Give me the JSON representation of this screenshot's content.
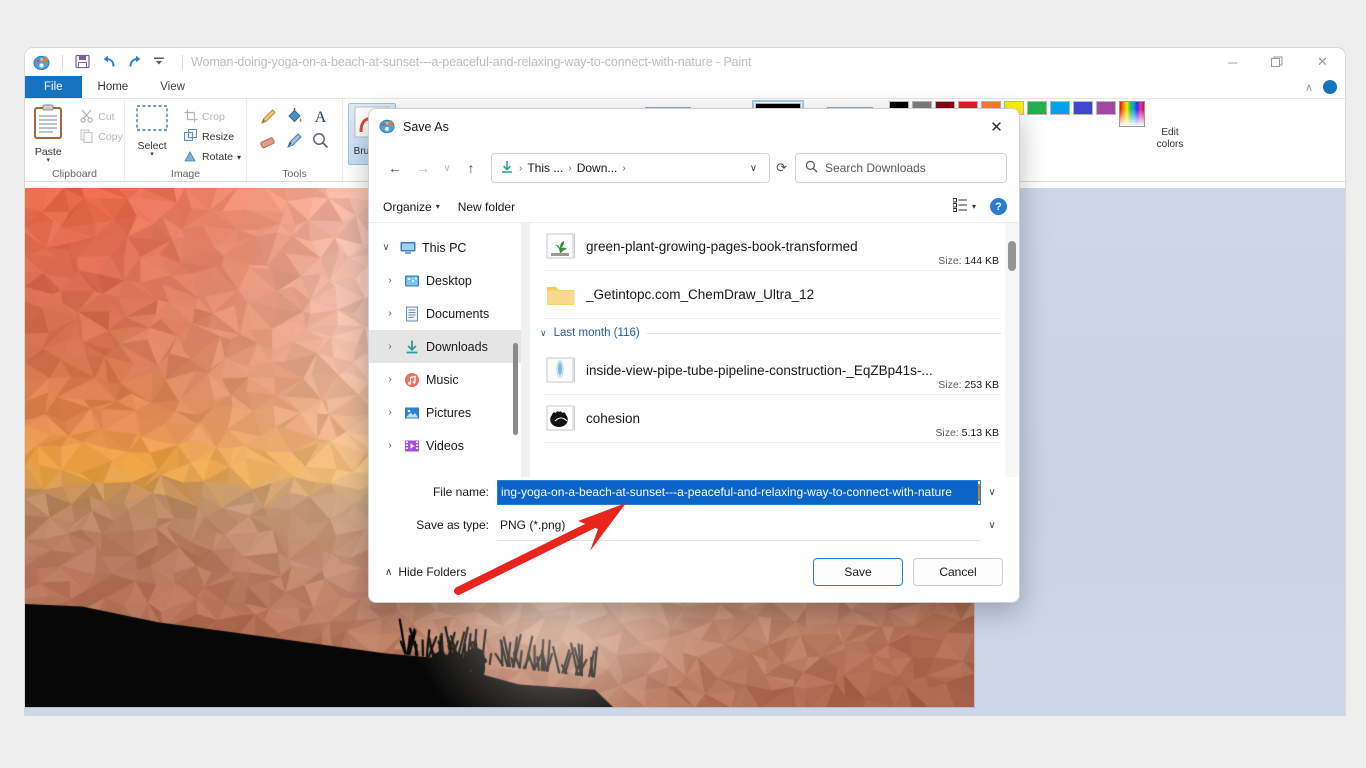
{
  "paint": {
    "title": "Woman-doing-yoga-on-a-beach-at-sunset---a-peaceful-and-relaxing-way-to-connect-with-nature - Paint",
    "quick_access": [
      "paint-icon",
      "save-icon",
      "undo-icon",
      "redo-icon",
      "customize-icon"
    ],
    "window_controls": {
      "minimize": "─",
      "restore": "❐",
      "close": "✕"
    },
    "ribbon_collapse": "∧",
    "tabs": [
      {
        "label": "File",
        "id": "file"
      },
      {
        "label": "Home",
        "id": "home"
      },
      {
        "label": "View",
        "id": "view"
      }
    ],
    "groups": [
      {
        "title": "Clipboard",
        "big": {
          "label": "Paste",
          "caret": "▼"
        },
        "small": [
          {
            "label": "Cut",
            "icon": "scissors-icon"
          },
          {
            "label": "Copy",
            "icon": "copy-icon"
          }
        ]
      },
      {
        "title": "Image",
        "big": {
          "label": "Select",
          "caret": "▼"
        },
        "small": [
          {
            "label": "Crop",
            "icon": "crop-icon"
          },
          {
            "label": "Resize",
            "icon": "resize-icon"
          },
          {
            "label": "Rotate",
            "icon": "rotate-icon",
            "caret": "▾"
          }
        ]
      },
      {
        "title": "Tools",
        "tools": [
          "pencil-icon",
          "fill-icon",
          "text-icon",
          "eraser-icon",
          "picker-icon",
          "magnifier-icon"
        ]
      },
      {
        "title": "Brushes",
        "big": {
          "label": "Brushes",
          "caret": "▼"
        }
      }
    ],
    "palette": {
      "colors": [
        "#000000",
        "#7f7f7f",
        "#880015",
        "#ed1c24",
        "#ff7f27",
        "#fff200",
        "#22b14c",
        "#00a2e8",
        "#3f48cc",
        "#a349a4"
      ],
      "selected_index": 0,
      "edit_colors_label": "Edit colors"
    }
  },
  "dialog": {
    "title": "Save As",
    "close": "✕",
    "nav": {
      "back": "←",
      "forward": "→",
      "recent": "∨",
      "up": "↑",
      "breadcrumb": [
        "This ...",
        "Down..."
      ],
      "breadcrumb_sep": "›",
      "breadcrumb_chevron": "∨",
      "refresh": "⟳",
      "search_placeholder": "Search Downloads"
    },
    "toolbar": {
      "organize": "Organize",
      "organize_caret": "▾",
      "new_folder": "New folder",
      "view_caret": "▾",
      "help": "?"
    },
    "nav_pane": [
      {
        "label": "This PC",
        "icon": "pc-icon",
        "twisty": "∨",
        "level": 0,
        "selected": false
      },
      {
        "label": "Desktop",
        "icon": "desktop-icon",
        "twisty": "›",
        "level": 1,
        "selected": false
      },
      {
        "label": "Documents",
        "icon": "documents-icon",
        "twisty": "›",
        "level": 1,
        "selected": false
      },
      {
        "label": "Downloads",
        "icon": "downloads-icon",
        "twisty": "›",
        "level": 1,
        "selected": true
      },
      {
        "label": "Music",
        "icon": "music-icon",
        "twisty": "›",
        "level": 1,
        "selected": false
      },
      {
        "label": "Pictures",
        "icon": "pictures-icon",
        "twisty": "›",
        "level": 1,
        "selected": false
      },
      {
        "label": "Videos",
        "icon": "videos-icon",
        "twisty": "›",
        "level": 1,
        "selected": false
      }
    ],
    "files": [
      {
        "name": "green-plant-growing-pages-book-transformed",
        "size_label": "Size:",
        "size": "144 KB",
        "icon": "image-plant-icon"
      },
      {
        "name": "_Getintopc.com_ChemDraw_Ultra_12",
        "size_label": "",
        "size": "",
        "icon": "folder-icon"
      }
    ],
    "group_header": {
      "chevron": "∨",
      "label": "Last month (116)"
    },
    "files2": [
      {
        "name": "inside-view-pipe-tube-pipeline-construction-_EqZBp41s-...",
        "size_label": "Size:",
        "size": "253 KB",
        "icon": "image-pipe-icon"
      },
      {
        "name": "cohesion",
        "size_label": "Size:",
        "size": "5.13 KB",
        "icon": "image-hands-icon"
      }
    ],
    "fields": {
      "filename_label": "File name:",
      "filename_value": "ing-yoga-on-a-beach-at-sunset---a-peaceful-and-relaxing-way-to-connect-with-nature",
      "savetype_label": "Save as type:",
      "savetype_value": "PNG (*.png)",
      "chevron": "∨"
    },
    "footer": {
      "hide_folders": "Hide Folders",
      "hide_folders_chevron": "∧",
      "save": "Save",
      "cancel": "Cancel"
    }
  },
  "annotation": {
    "arrow_color": "#e8251c",
    "arrow_name": "red-arrow-pointing-to-filename"
  },
  "colors": {
    "accent": "#1673c0",
    "dialog_selection": "#0b64c8",
    "desktop": "#eeeeee",
    "workspace": "#ccd6e8"
  }
}
